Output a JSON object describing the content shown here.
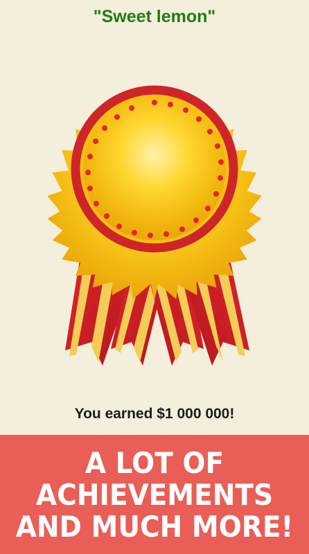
{
  "achievement": {
    "title": "\"Sweet lemon\""
  },
  "reward": {
    "text": "You earned $1 000 000!"
  },
  "promo": {
    "lines": [
      "A LOT OF",
      "ACHIEVEMENTS",
      "AND MUCH MORE!"
    ]
  },
  "colors": {
    "background": "#f4efdc",
    "title_green": "#1f7d14",
    "banner_red": "#e95e56",
    "badge_gold": "#f7c815",
    "ribbon_red": "#c81f24",
    "ribbon_stripe": "#f2c94c"
  },
  "icons": {
    "badge": "award-rosette-icon"
  }
}
